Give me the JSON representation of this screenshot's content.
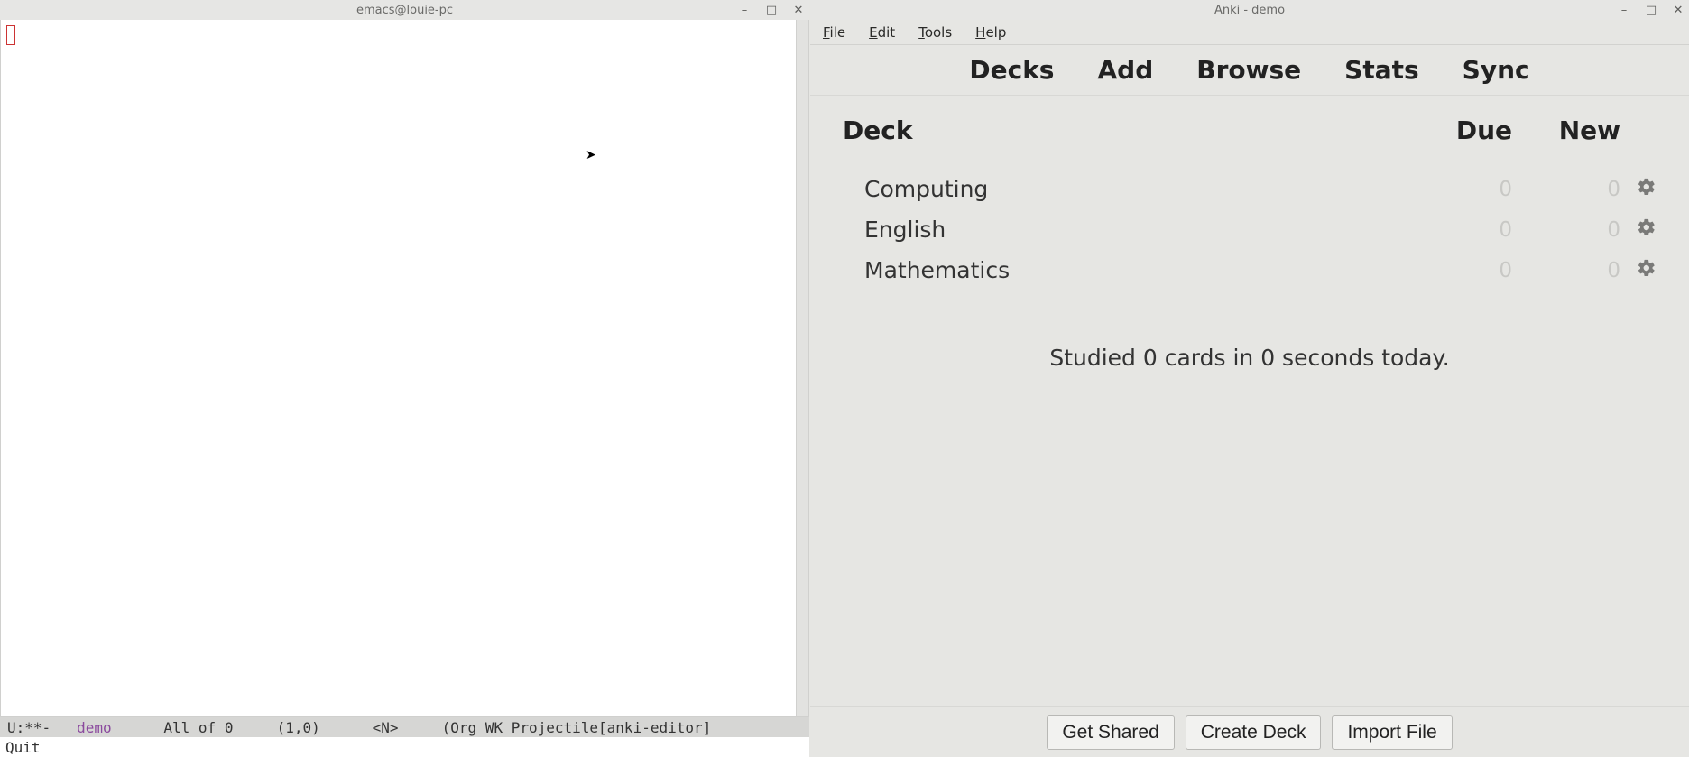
{
  "emacs": {
    "title": "emacs@louie-pc",
    "modeline": {
      "prefix": "U:**-   ",
      "buffer": "demo",
      "position": "      All of 0     (1,0)      <N>     (Org WK Projectile[anki-editor]"
    },
    "minibuffer": "Quit"
  },
  "anki": {
    "title": "Anki - demo",
    "menubar": [
      "File",
      "Edit",
      "Tools",
      "Help"
    ],
    "toolbar": [
      "Decks",
      "Add",
      "Browse",
      "Stats",
      "Sync"
    ],
    "columns": {
      "deck": "Deck",
      "due": "Due",
      "new": "New"
    },
    "decks": [
      {
        "name": "Computing",
        "due": "0",
        "new": "0"
      },
      {
        "name": "English",
        "due": "0",
        "new": "0"
      },
      {
        "name": "Mathematics",
        "due": "0",
        "new": "0"
      }
    ],
    "status": "Studied 0 cards in 0 seconds today.",
    "footer": {
      "get_shared": "Get Shared",
      "create_deck": "Create Deck",
      "import_file": "Import File"
    }
  }
}
